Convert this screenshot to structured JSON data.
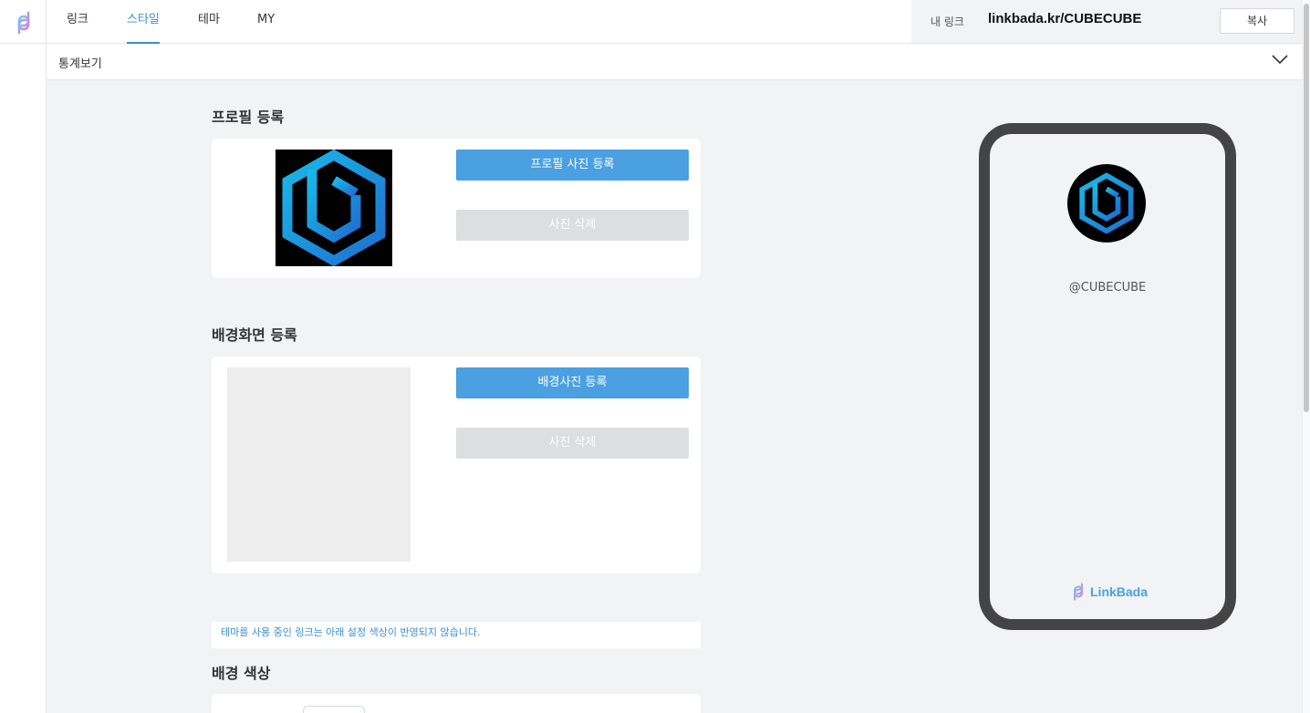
{
  "nav": {
    "tabs": [
      {
        "label": "링크"
      },
      {
        "label": "스타일"
      },
      {
        "label": "테마"
      },
      {
        "label": "MY"
      }
    ],
    "active_tab": "스타일",
    "my_link_label": "내 링크",
    "my_link_url": "linkbada.kr/CUBECUBE",
    "copy_label": "복사"
  },
  "stats": {
    "label": "통계보기"
  },
  "profile_section": {
    "title": "프로필 등록",
    "upload_label": "프로필 사진 등록",
    "delete_label": "사진 삭제"
  },
  "background_section": {
    "title": "배경화면 등록",
    "upload_label": "배경사진 등록",
    "delete_label": "사진 삭제"
  },
  "theme_notice": "테마를 사용 중인 링크는 아래 설정 색상이 반영되지 않습니다.",
  "bg_color_section": {
    "title": "배경 색상"
  },
  "preview": {
    "handle": "@CUBECUBE",
    "brand": "LinkBada"
  },
  "colors": {
    "accent": "#4aa0e0",
    "tab_active": "#3a8fd6",
    "disabled": "#dcdee0",
    "phone_frame": "#444444",
    "logo_cyan": "#1ab8e8",
    "logo_blue": "#1e6fd0"
  }
}
